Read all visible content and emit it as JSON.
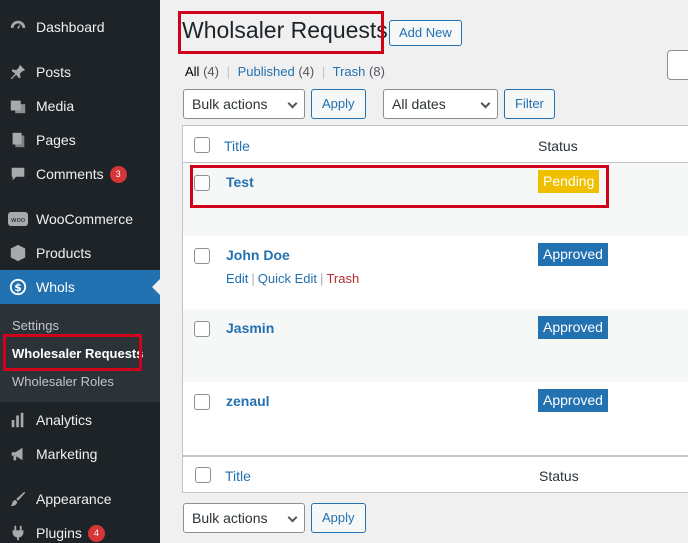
{
  "sidebar": {
    "items": [
      {
        "label": "Dashboard",
        "icon": "dashboard-icon"
      },
      {
        "label": "Posts",
        "icon": "pin-icon"
      },
      {
        "label": "Media",
        "icon": "media-icon"
      },
      {
        "label": "Pages",
        "icon": "page-icon"
      },
      {
        "label": "Comments",
        "icon": "comment-icon",
        "badge": "3"
      },
      {
        "label": "WooCommerce",
        "icon": "woocommerce-icon"
      },
      {
        "label": "Products",
        "icon": "box-icon"
      },
      {
        "label": "Whols",
        "icon": "dollar-icon",
        "current": true
      },
      {
        "label": "Analytics",
        "icon": "bar-chart-icon"
      },
      {
        "label": "Marketing",
        "icon": "megaphone-icon"
      },
      {
        "label": "Appearance",
        "icon": "paintbrush-icon"
      },
      {
        "label": "Plugins",
        "icon": "plug-icon",
        "badge": "4"
      }
    ],
    "submenu": [
      {
        "label": "Settings"
      },
      {
        "label": "Wholesaler Requests",
        "current": true
      },
      {
        "label": "Wholesaler Roles"
      }
    ]
  },
  "header": {
    "title": "Wholsaler Requests",
    "add_new_label": "Add New"
  },
  "views": {
    "all": "All",
    "all_count": "(4)",
    "published": "Published",
    "published_count": "(4)",
    "trash": "Trash",
    "trash_count": "(8)",
    "separator": "|"
  },
  "toolbar": {
    "bulk_actions": "Bulk actions",
    "apply_label": "Apply",
    "dates": "All dates",
    "filter_label": "Filter"
  },
  "table": {
    "columns": {
      "title": "Title",
      "status": "Status"
    },
    "rows": [
      {
        "title": "Test",
        "status": "Pending"
      },
      {
        "title": "John Doe",
        "status": "Approved",
        "actions": [
          "Edit",
          "Quick Edit",
          "Trash"
        ]
      },
      {
        "title": "Jasmin",
        "status": "Approved"
      },
      {
        "title": "zenaul",
        "status": "Approved"
      }
    ]
  },
  "colors": {
    "accent": "#2271b1",
    "sidebar_bg": "#1d2327",
    "pending": "#f0c000",
    "highlight": "#d0021b"
  }
}
